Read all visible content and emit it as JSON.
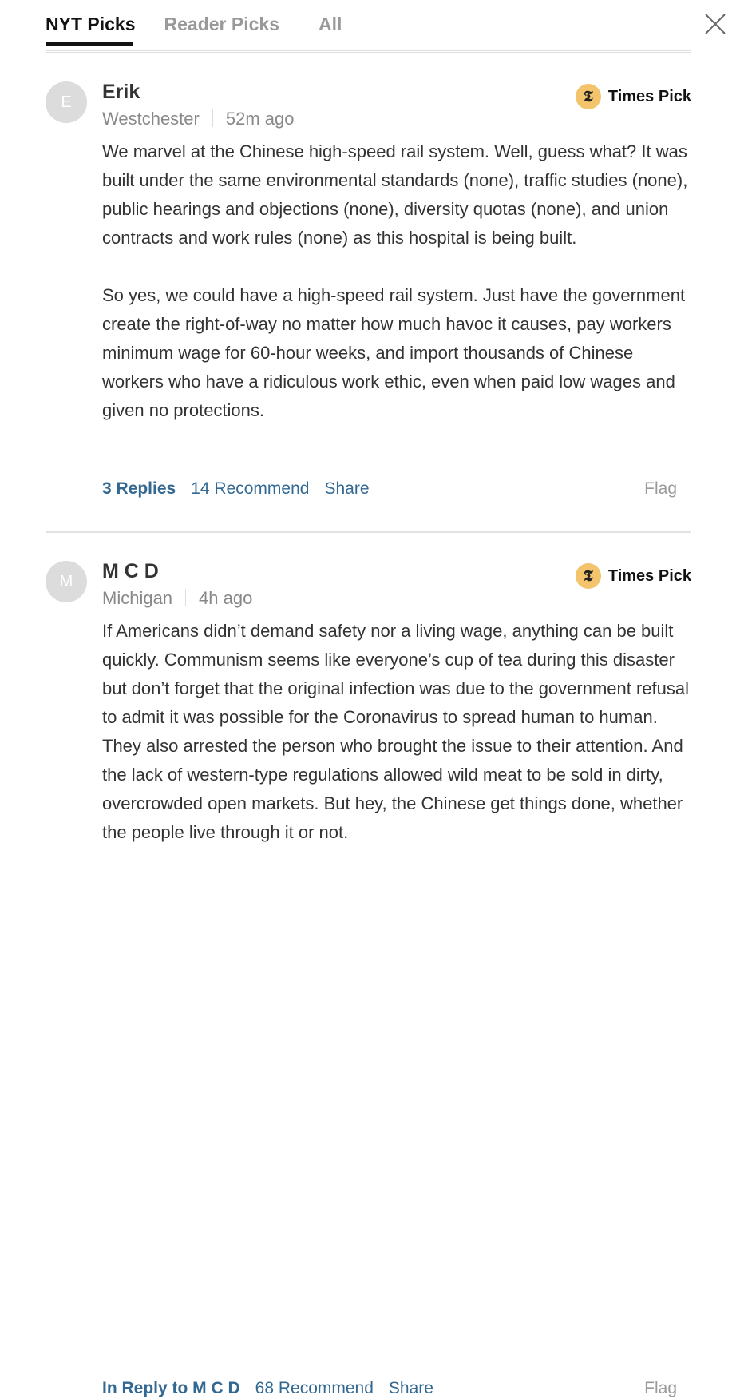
{
  "tabs": [
    {
      "label": "NYT Picks",
      "active": true
    },
    {
      "label": "Reader Picks",
      "active": false
    },
    {
      "label": "All",
      "active": false
    }
  ],
  "close_icon": "close-icon",
  "colors": {
    "link": "#326891",
    "pick_badge": "#f3c46b",
    "muted": "#999999"
  },
  "comments": [
    {
      "avatar_initial": "E",
      "author": "Erik",
      "location": "Westchester",
      "time": "52m ago",
      "badge": "Times Pick",
      "badge_icon": "nyt-t-logo-icon",
      "paragraphs": [
        "We marvel at the Chinese high-speed rail system. Well, guess what? It was built under the same environmental standards (none), traffic studies (none), public hearings and objections (none), diversity quotas (none), and union contracts and work rules (none) as this hospital is being built.",
        "So yes, we could have a high-speed rail system. Just have the government create the right-of-way no matter how much havoc it causes, pay workers minimum wage for 60-hour weeks, and import thousands of Chinese workers who have a ridiculous work ethic, even when paid low wages and given no protections."
      ],
      "actions": {
        "replies": "3 Replies",
        "recommend": "14 Recommend",
        "share": "Share",
        "flag": "Flag"
      }
    },
    {
      "avatar_initial": "M",
      "author": "M C D",
      "location": "Michigan",
      "time": "4h ago",
      "badge": "Times Pick",
      "badge_icon": "nyt-t-logo-icon",
      "paragraphs": [
        "If Americans didn’t demand safety nor a living wage, anything can be built quickly. Communism seems like everyone’s cup of tea during this disaster but don’t forget that the original infection was due to the government refusal to admit it was possible for the Coronavirus to spread human to human. They also arrested the person who brought the issue to their attention. And the lack of western-type regulations allowed wild meat to be sold in dirty, overcrowded open markets. But hey, the Chinese get things done, whether the people live through it or not."
      ],
      "actions": {
        "reply": "In Reply to M C D",
        "recommend": "68 Recommend",
        "share": "Share",
        "flag": "Flag"
      }
    }
  ]
}
